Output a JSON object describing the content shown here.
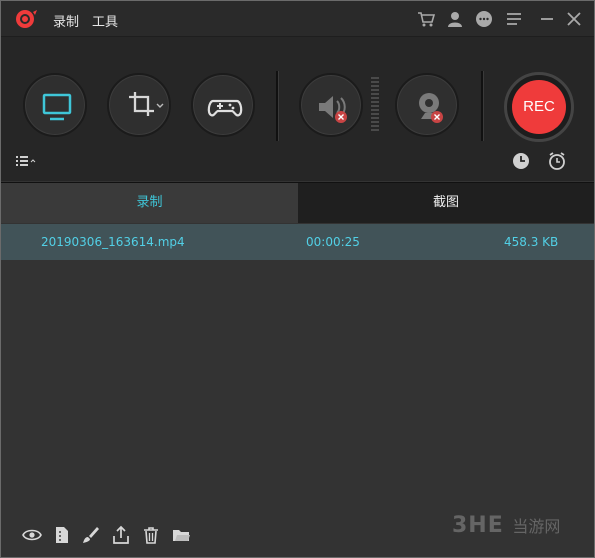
{
  "menu": {
    "record": "录制",
    "tools": "工具"
  },
  "tabs": {
    "record": "录制",
    "screenshot": "截图"
  },
  "recording": {
    "filename": "20190306_163614.mp4",
    "duration": "00:00:25",
    "size": "458.3 KB"
  },
  "rec_button": {
    "label": "REC"
  },
  "watermark": {
    "brand": "3HE",
    "site": "当游网"
  },
  "colors": {
    "accent": "#3fc6d8",
    "rec_red": "#ef3b3b",
    "row_bg": "#415358"
  },
  "icons": {
    "titlebar": [
      "cart-icon",
      "user-icon",
      "chat-icon",
      "menu-icon",
      "minimize-icon",
      "close-icon"
    ],
    "modes": [
      "screen-icon",
      "crop-region-icon",
      "gamepad-icon"
    ],
    "audio": [
      "speaker-muted-icon",
      "webcam-disabled-icon"
    ],
    "bottom": [
      "eye-icon",
      "file-icon",
      "brush-icon",
      "share-icon",
      "trash-icon",
      "folder-icon"
    ]
  }
}
